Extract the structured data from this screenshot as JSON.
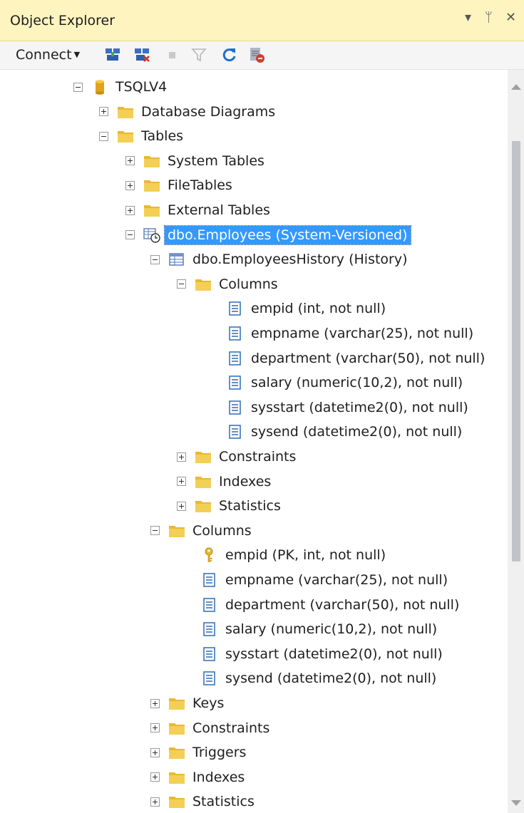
{
  "panel": {
    "title": "Object Explorer",
    "dropdown_icon": "dropdown-arrow-icon",
    "pin_icon": "pin-icon",
    "close_icon": "close-icon",
    "dropdown_glyph": "▾",
    "pin_glyph": "ᛘ",
    "close_glyph": "✕"
  },
  "toolbar": {
    "connect_label": "Connect",
    "icons": [
      "connect-object-explorer-icon",
      "disconnect-icon",
      "stop-icon",
      "filter-icon",
      "refresh-icon",
      "activity-monitor-icon"
    ]
  },
  "colors": {
    "title_bar": "#fdf4bf",
    "selection": "#3399ff",
    "folder": "#e8b931",
    "column_icon_blue": "#2f6db5"
  },
  "tree": [
    {
      "label": "TSQLV4",
      "icon": "database-icon",
      "level": 0,
      "expander": "minus"
    },
    {
      "label": "Database Diagrams",
      "icon": "folder-icon",
      "level": 1,
      "expander": "plus"
    },
    {
      "label": "Tables",
      "icon": "folder-icon",
      "level": 1,
      "expander": "minus"
    },
    {
      "label": "System Tables",
      "icon": "folder-icon",
      "level": 2,
      "expander": "plus"
    },
    {
      "label": "FileTables",
      "icon": "folder-icon",
      "level": 2,
      "expander": "plus"
    },
    {
      "label": "External Tables",
      "icon": "folder-icon",
      "level": 2,
      "expander": "plus"
    },
    {
      "label": "dbo.Employees (System-Versioned)",
      "icon": "temporal-table-icon",
      "level": 2,
      "expander": "minus",
      "selected": true
    },
    {
      "label": "dbo.EmployeesHistory (History)",
      "icon": "table-icon",
      "level": 3,
      "expander": "minus"
    },
    {
      "label": "Columns",
      "icon": "folder-icon",
      "level": 4,
      "expander": "minus"
    },
    {
      "label": "empid (int, not null)",
      "icon": "column-icon",
      "level": 5,
      "expander": "none"
    },
    {
      "label": "empname (varchar(25), not null)",
      "icon": "column-icon",
      "level": 5,
      "expander": "none"
    },
    {
      "label": "department (varchar(50), not null)",
      "icon": "column-icon",
      "level": 5,
      "expander": "none"
    },
    {
      "label": "salary (numeric(10,2), not null)",
      "icon": "column-icon",
      "level": 5,
      "expander": "none"
    },
    {
      "label": "sysstart (datetime2(0), not null)",
      "icon": "column-icon",
      "level": 5,
      "expander": "none"
    },
    {
      "label": "sysend (datetime2(0), not null)",
      "icon": "column-icon",
      "level": 5,
      "expander": "none"
    },
    {
      "label": "Constraints",
      "icon": "folder-icon",
      "level": 4,
      "expander": "plus"
    },
    {
      "label": "Indexes",
      "icon": "folder-icon",
      "level": 4,
      "expander": "plus"
    },
    {
      "label": "Statistics",
      "icon": "folder-icon",
      "level": 4,
      "expander": "plus"
    },
    {
      "label": "Columns",
      "icon": "folder-icon",
      "level": 3,
      "expander": "minus"
    },
    {
      "label": "empid (PK, int, not null)",
      "icon": "key-icon",
      "level": 4,
      "expander": "none"
    },
    {
      "label": "empname (varchar(25), not null)",
      "icon": "column-icon",
      "level": 4,
      "expander": "none"
    },
    {
      "label": "department (varchar(50), not null)",
      "icon": "column-icon",
      "level": 4,
      "expander": "none"
    },
    {
      "label": "salary (numeric(10,2), not null)",
      "icon": "column-icon",
      "level": 4,
      "expander": "none"
    },
    {
      "label": "sysstart (datetime2(0), not null)",
      "icon": "column-icon",
      "level": 4,
      "expander": "none"
    },
    {
      "label": "sysend (datetime2(0), not null)",
      "icon": "column-icon",
      "level": 4,
      "expander": "none"
    },
    {
      "label": "Keys",
      "icon": "folder-icon",
      "level": 3,
      "expander": "plus"
    },
    {
      "label": "Constraints",
      "icon": "folder-icon",
      "level": 3,
      "expander": "plus"
    },
    {
      "label": "Triggers",
      "icon": "folder-icon",
      "level": 3,
      "expander": "plus"
    },
    {
      "label": "Indexes",
      "icon": "folder-icon",
      "level": 3,
      "expander": "plus"
    },
    {
      "label": "Statistics",
      "icon": "folder-icon",
      "level": 3,
      "expander": "plus"
    }
  ]
}
